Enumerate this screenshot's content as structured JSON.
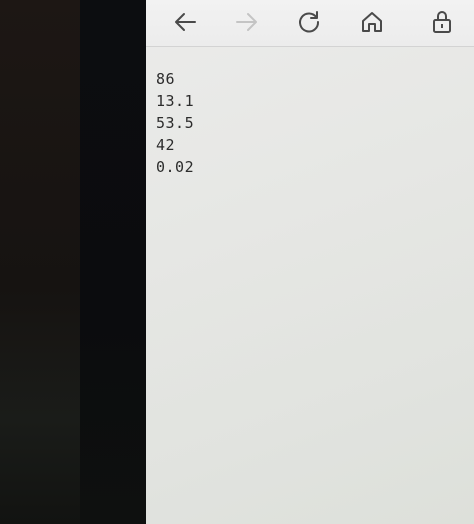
{
  "browser": {
    "toolbar": {
      "icons": [
        "back-arrow-icon",
        "forward-arrow-icon",
        "refresh-icon",
        "home-icon",
        "lock-icon"
      ],
      "forward_enabled": false
    }
  },
  "page": {
    "lines": [
      "86",
      "13.1",
      "53.5",
      "42",
      "0.02"
    ]
  }
}
